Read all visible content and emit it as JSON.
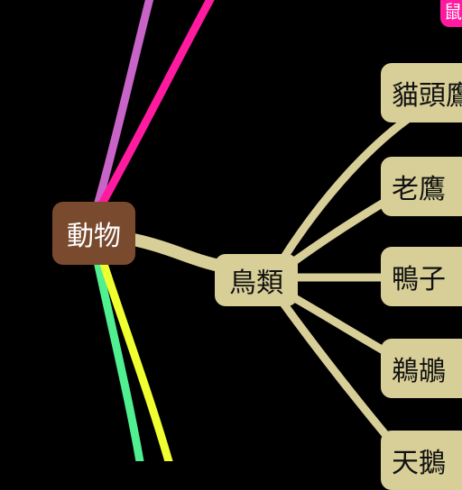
{
  "colors": {
    "background": "#000000",
    "root_fill": "#7a4a2e",
    "branch_fill": "#d8cf98",
    "link_violet": "#c864c8",
    "link_magenta": "#ff1aa0",
    "link_green": "#50f090",
    "link_yellow": "#f0ff30",
    "link_tan": "#d8cf98",
    "corner_node_fill": "#ff1aa0"
  },
  "mindmap": {
    "root": {
      "label": "動物"
    },
    "branch": {
      "label": "鳥類"
    },
    "leaves": [
      {
        "label": "貓頭鷹"
      },
      {
        "label": "老鷹"
      },
      {
        "label": "鴨子"
      },
      {
        "label": "鵜鶘"
      },
      {
        "label": "天鵝"
      }
    ],
    "corner_node": {
      "label": "鼠"
    }
  }
}
